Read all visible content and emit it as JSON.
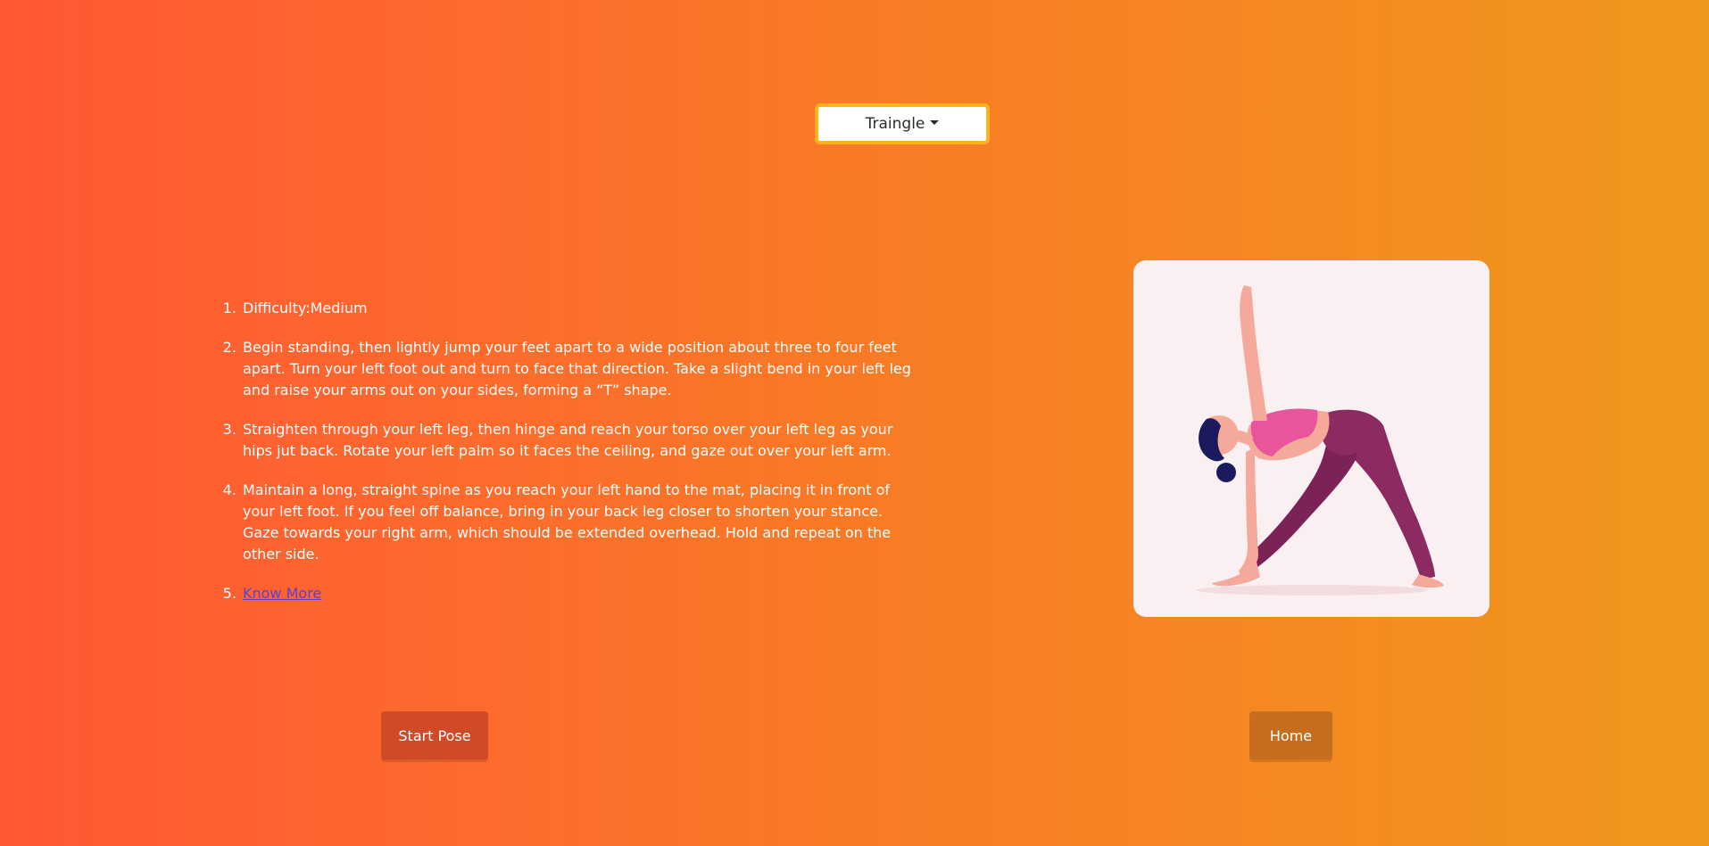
{
  "dropdown": {
    "selected": "Traingle",
    "caret_icon": "caret-down-icon"
  },
  "instructions": {
    "items": [
      "Difficulty:Medium",
      "Begin standing, then lightly jump your feet apart to a wide position about three to four feet apart. Turn your left foot out and turn to face that direction. Take a slight bend in your left leg and raise your arms out on your sides, forming a “T” shape.",
      "Straighten through your left leg, then hinge and reach your torso over your left leg as your hips jut back. Rotate your left palm so it faces the ceiling, and gaze out over your left arm.",
      "Maintain a long, straight spine as you reach your left hand to the mat, placing it in front of your left foot. If you feel off balance, bring in your back leg closer to shorten your stance. Gaze towards your right arm, which should be extended overhead. Hold and repeat on the other side."
    ],
    "link_label": "Know More"
  },
  "buttons": {
    "start_label": "Start Pose",
    "home_label": "Home"
  },
  "colors": {
    "gradient_start": "#ff5734",
    "gradient_end": "#f0981c",
    "dropdown_border": "#ffb21d",
    "start_button": "#d04a27",
    "home_button": "#c66d1e",
    "link": "#5b3fd6"
  }
}
